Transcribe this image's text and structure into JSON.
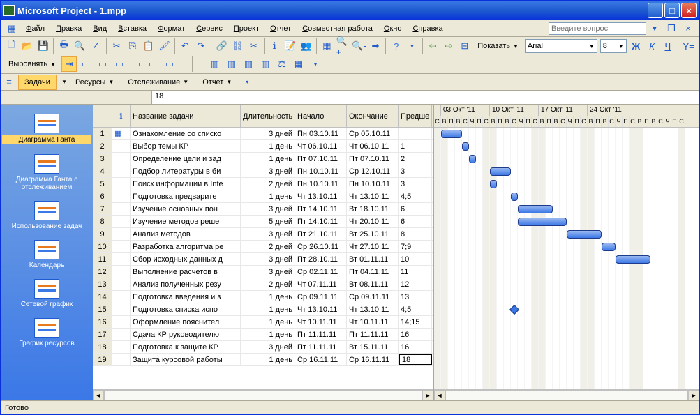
{
  "title": "Microsoft Project - 1.mpp",
  "menu": [
    "Файл",
    "Правка",
    "Вид",
    "Вставка",
    "Формат",
    "Сервис",
    "Проект",
    "Отчет",
    "Совместная работа",
    "Окно",
    "Справка"
  ],
  "ask_placeholder": "Введите вопрос",
  "show_label": "Показать",
  "font_name": "Arial",
  "font_size": "8",
  "align_label": "Выровнять",
  "viewbar": {
    "tasks": "Задачи",
    "resources": "Ресурсы",
    "tracking": "Отслеживание",
    "report": "Отчет"
  },
  "formula_value": "18",
  "sidebar": [
    {
      "label": "Диаграмма Ганта",
      "sel": true
    },
    {
      "label": "Диаграмма Ганта с отслеживанием"
    },
    {
      "label": "Использование задач"
    },
    {
      "label": "Календарь"
    },
    {
      "label": "Сетевой график"
    },
    {
      "label": "График ресурсов"
    }
  ],
  "columns": {
    "info": "",
    "name": "Название задачи",
    "dur": "Длительность",
    "start": "Начало",
    "end": "Окончание",
    "pred": "Предше"
  },
  "rows": [
    {
      "n": 1,
      "name": "Ознакомление со списко",
      "dur": "3 дней",
      "start": "Пн 03.10.11",
      "end": "Ср 05.10.11",
      "pred": "",
      "i": true
    },
    {
      "n": 2,
      "name": "Выбор темы КР",
      "dur": "1 день",
      "start": "Чт 06.10.11",
      "end": "Чт 06.10.11",
      "pred": "1"
    },
    {
      "n": 3,
      "name": "Определение цели и зад",
      "dur": "1 день",
      "start": "Пт 07.10.11",
      "end": "Пт 07.10.11",
      "pred": "2"
    },
    {
      "n": 4,
      "name": "Подбор литературы в би",
      "dur": "3 дней",
      "start": "Пн 10.10.11",
      "end": "Ср 12.10.11",
      "pred": "3"
    },
    {
      "n": 5,
      "name": "Поиск информации в Inte",
      "dur": "2 дней",
      "start": "Пн 10.10.11",
      "end": "Пн 10.10.11",
      "pred": "3"
    },
    {
      "n": 6,
      "name": "Подготовка предварите",
      "dur": "1 день",
      "start": "Чт 13.10.11",
      "end": "Чт 13.10.11",
      "pred": "4;5"
    },
    {
      "n": 7,
      "name": "Изучение основных пон",
      "dur": "3 дней",
      "start": "Пт 14.10.11",
      "end": "Вт 18.10.11",
      "pred": "6"
    },
    {
      "n": 8,
      "name": "Изучение методов реше",
      "dur": "5 дней",
      "start": "Пт 14.10.11",
      "end": "Чт 20.10.11",
      "pred": "6"
    },
    {
      "n": 9,
      "name": "Анализ методов",
      "dur": "3 дней",
      "start": "Пт 21.10.11",
      "end": "Вт 25.10.11",
      "pred": "8"
    },
    {
      "n": 10,
      "name": "Разработка алгоритма ре",
      "dur": "2 дней",
      "start": "Ср 26.10.11",
      "end": "Чт 27.10.11",
      "pred": "7;9"
    },
    {
      "n": 11,
      "name": "Сбор исходных данных д",
      "dur": "3 дней",
      "start": "Пт 28.10.11",
      "end": "Вт 01.11.11",
      "pred": "10"
    },
    {
      "n": 12,
      "name": "Выполнение расчетов в",
      "dur": "3 дней",
      "start": "Ср 02.11.11",
      "end": "Пт 04.11.11",
      "pred": "11"
    },
    {
      "n": 13,
      "name": "Анализ полученных резу",
      "dur": "2 дней",
      "start": "Чт 07.11.11",
      "end": "Вт 08.11.11",
      "pred": "12"
    },
    {
      "n": 14,
      "name": "Подготовка введения и з",
      "dur": "1 день",
      "start": "Ср 09.11.11",
      "end": "Ср 09.11.11",
      "pred": "13"
    },
    {
      "n": 15,
      "name": "Подготовка списка испо",
      "dur": "1 день",
      "start": "Чт 13.10.11",
      "end": "Чт 13.10.11",
      "pred": "4;5"
    },
    {
      "n": 16,
      "name": "Оформление пояснител",
      "dur": "1 день",
      "start": "Чт 10.11.11",
      "end": "Чт 10.11.11",
      "pred": "14;15"
    },
    {
      "n": 17,
      "name": "Сдача КР руководителю",
      "dur": "1 день",
      "start": "Пт 11.11.11",
      "end": "Пт 11.11.11",
      "pred": "16"
    },
    {
      "n": 18,
      "name": "Подготовка к защите КР",
      "dur": "3 дней",
      "start": "Пт 11.11.11",
      "end": "Вт 15.11.11",
      "pred": "16"
    },
    {
      "n": 19,
      "name": "Защита курсовой работы",
      "dur": "1 день",
      "start": "Ср 16.11.11",
      "end": "Ср 16.11.11",
      "pred": "18"
    }
  ],
  "weeks": [
    "03 Окт '11",
    "10 Окт '11",
    "17 Окт '11",
    "24 Окт '11"
  ],
  "days": [
    "В",
    "П",
    "В",
    "С",
    "Ч",
    "П",
    "С"
  ],
  "status": "Готово",
  "selected_pred": "18",
  "chart_data": {
    "type": "bar",
    "title": "Gantt chart",
    "tasks": [
      {
        "id": 1,
        "start": "2011-10-03",
        "end": "2011-10-05"
      },
      {
        "id": 2,
        "start": "2011-10-06",
        "end": "2011-10-06"
      },
      {
        "id": 3,
        "start": "2011-10-07",
        "end": "2011-10-07"
      },
      {
        "id": 4,
        "start": "2011-10-10",
        "end": "2011-10-12"
      },
      {
        "id": 5,
        "start": "2011-10-10",
        "end": "2011-10-10"
      },
      {
        "id": 6,
        "start": "2011-10-13",
        "end": "2011-10-13"
      },
      {
        "id": 7,
        "start": "2011-10-14",
        "end": "2011-10-18"
      },
      {
        "id": 8,
        "start": "2011-10-14",
        "end": "2011-10-20"
      },
      {
        "id": 9,
        "start": "2011-10-21",
        "end": "2011-10-25"
      },
      {
        "id": 10,
        "start": "2011-10-26",
        "end": "2011-10-27"
      },
      {
        "id": 11,
        "start": "2011-10-28",
        "end": "2011-11-01"
      },
      {
        "id": 15,
        "start": "2011-10-13",
        "end": "2011-10-13",
        "milestone": true
      }
    ]
  }
}
